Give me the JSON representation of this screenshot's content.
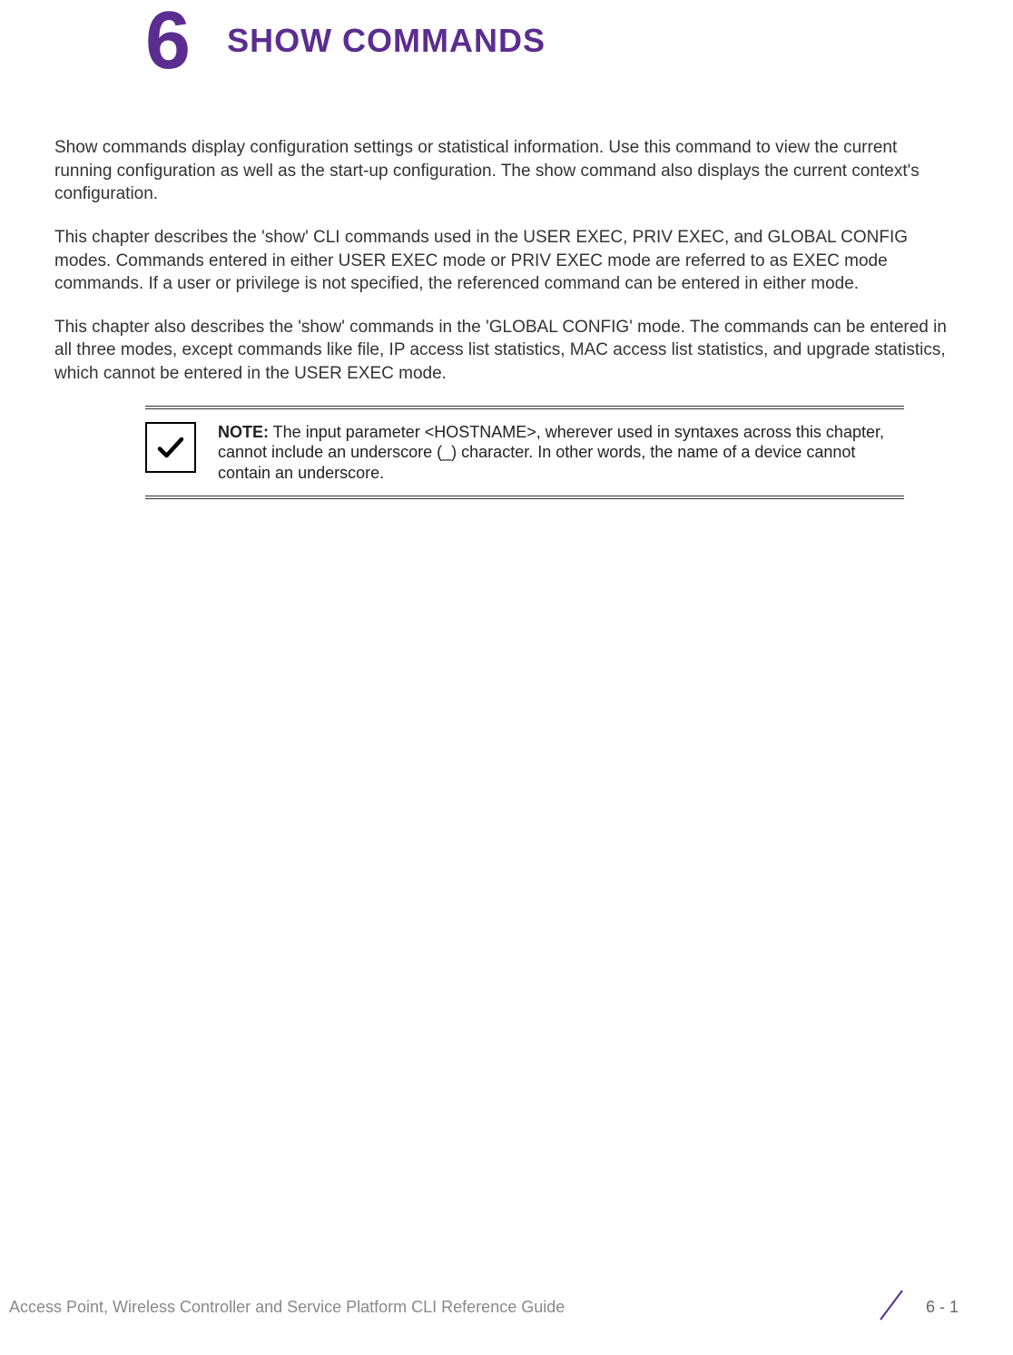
{
  "chapter": {
    "number": "6",
    "title": "SHOW COMMANDS"
  },
  "paragraphs": [
    "Show commands display configuration settings or statistical information. Use this command to view the current running configuration as well as the start-up configuration. The show command also displays the current context's configuration.",
    "This chapter describes the 'show' CLI commands used in the USER EXEC, PRIV EXEC, and GLOBAL CONFIG modes. Commands entered in either USER EXEC mode or PRIV EXEC mode are referred to as EXEC mode commands. If a user or privilege is not specified, the referenced command can be entered in either mode.",
    "This chapter also describes the 'show' commands in the 'GLOBAL CONFIG' mode. The commands can be entered in all three modes, except commands like file, IP access list statistics, MAC access list statistics, and upgrade statistics, which cannot be entered in the USER EXEC mode."
  ],
  "note": {
    "label": "NOTE:",
    "text": " The input parameter <HOSTNAME>, wherever used in syntaxes across this chapter, cannot include an underscore (_) character. In other words, the name of a device cannot contain an underscore."
  },
  "footer": {
    "title": "Access Point, Wireless Controller and Service Platform CLI Reference Guide",
    "page": "6 - 1"
  }
}
